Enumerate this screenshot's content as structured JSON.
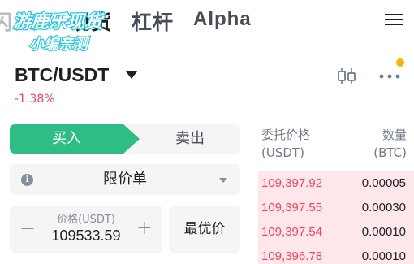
{
  "top_tabs": {
    "cut_label": "闪",
    "spot_label": "现货",
    "lever_label": "杠杆",
    "alpha_label": "Alpha"
  },
  "watermark": {
    "line1": "游鹿乐现货",
    "line2": "小编亲测"
  },
  "pair": {
    "symbol": "BTC/USDT",
    "change": "-1.38%"
  },
  "trade_side": {
    "buy_label": "买入",
    "sell_label": "卖出"
  },
  "order_type": {
    "selected": "限价单"
  },
  "price_input": {
    "label": "价格(USDT)",
    "value": "109533.59",
    "minus": "−",
    "plus": "+"
  },
  "best_price_label": "最优价",
  "order_book": {
    "price_header": "委托价格",
    "price_unit": "(USDT)",
    "qty_header": "数量",
    "qty_unit": "(BTC)",
    "asks": [
      {
        "price": "109,397.92",
        "qty": "0.00005"
      },
      {
        "price": "109,397.55",
        "qty": "0.00030"
      },
      {
        "price": "109,397.54",
        "qty": "0.00010"
      },
      {
        "price": "109,396.78",
        "qty": "0.00010"
      }
    ]
  },
  "colors": {
    "buy": "#2ebd85",
    "sell": "#f6465d",
    "accent_dot": "#f0b90b"
  },
  "icons": [
    "menu-icon",
    "kline-icon",
    "more-icon",
    "info-icon",
    "chevron-down-icon"
  ]
}
